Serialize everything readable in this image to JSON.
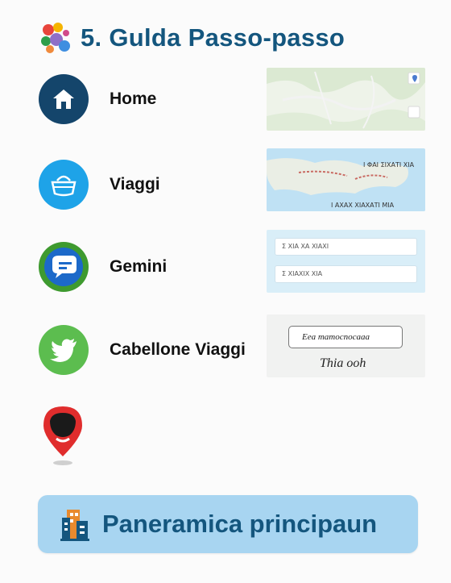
{
  "header": {
    "title": "5. Gulda Passo-passo",
    "logo_icon": "colorful-cluster-logo"
  },
  "items": [
    {
      "label": "Home",
      "icon": "house-icon",
      "color": "#14456b"
    },
    {
      "label": "Viaggi",
      "icon": "basket-icon",
      "color": "#1ea3e8"
    },
    {
      "label": "Gemini",
      "icon": "chat-bubble-icon",
      "color": "#3e9a2f"
    },
    {
      "label": "Cabellone Viaggi",
      "icon": "bird-icon",
      "color": "#5cbd4f"
    }
  ],
  "thumbnails": {
    "map_home": {
      "icon": "map-pin-icon"
    },
    "map_viaggi": {
      "caption": "Ι ΦΑΙ ΣΙΧΑΤΙ ΧΙΑ",
      "footer": "Ι ΑΧΑΧ ΧΙΑΧΑΤΙ ΜΙΑ"
    },
    "gemini_list": {
      "row1": "Σ ΧΙΑ ΧΑ ΧΙΑΧΙ",
      "row2": "Σ ΧΙΑΧΙΧ ΧΙΑ"
    },
    "cabellone": {
      "button_text": "Eea mamocnocaaa",
      "script_text": "Thia ooh"
    }
  },
  "pin_icon": "red-location-pin-icon",
  "banner": {
    "text": "Paneramica principaun",
    "icon": "building-icon"
  }
}
